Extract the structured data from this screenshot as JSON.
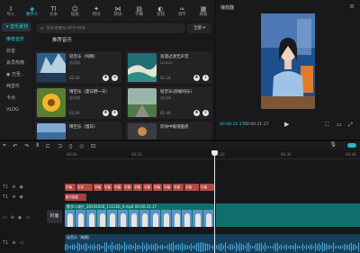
{
  "toolbar": {
    "tools": [
      {
        "icon": "import-icon",
        "glyph": "⇩",
        "label": "导入"
      },
      {
        "icon": "media-icon",
        "glyph": "◈",
        "label": "数字人",
        "active": true
      },
      {
        "icon": "text-icon",
        "glyph": "TI",
        "label": "文本"
      },
      {
        "icon": "sticker-icon",
        "glyph": "☺",
        "label": "贴纸"
      },
      {
        "icon": "effects-icon",
        "glyph": "✦",
        "label": "特效"
      },
      {
        "icon": "transition-icon",
        "glyph": "⋈",
        "label": "转场"
      },
      {
        "icon": "caption-icon",
        "glyph": "▤",
        "label": "字幕"
      },
      {
        "icon": "filter-icon",
        "glyph": "◐",
        "label": "滤镜"
      },
      {
        "icon": "adjust-icon",
        "glyph": "≈",
        "label": "调节"
      },
      {
        "icon": "template-icon",
        "glyph": "▦",
        "label": "模板"
      }
    ]
  },
  "leftnav": {
    "items": [
      {
        "label": "▾ 音乐素材",
        "state": "active"
      },
      {
        "label": "推荐音乐",
        "state": "sub"
      },
      {
        "label": "抖音",
        "state": ""
      },
      {
        "label": "会员热榜",
        "state": ""
      },
      {
        "label": "◉ 万圣...",
        "state": ""
      },
      {
        "label": "纯音乐",
        "state": ""
      },
      {
        "label": "卡点",
        "state": ""
      },
      {
        "label": "VLOG",
        "state": ""
      }
    ]
  },
  "media": {
    "search_placeholder": "搜索歌曲名/歌手/链接",
    "filter_label": "全部 ▾",
    "section_title": "推荐音乐",
    "cards": [
      {
        "title": "轻音乐（纯钢）",
        "artist": "若风纯",
        "duration": "02:50"
      },
      {
        "title": "浪漫过渡无声音",
        "artist": "Lyonzo",
        "duration": "01:18"
      },
      {
        "title": "晴空乐（夏日野一天）",
        "artist": "若风纯",
        "duration": "02:24"
      },
      {
        "title": "轻音乐(舒缓纯乐)",
        "artist": "若风纯",
        "duration": "01:49"
      },
      {
        "title": "晴空乐（慢日）",
        "artist": "",
        "duration": ""
      },
      {
        "title": "欢快中暖夜酷摇",
        "artist": "",
        "duration": ""
      }
    ]
  },
  "player": {
    "title": "播放器",
    "current_time": "00:00:21:17",
    "total_time": "00:00:21:17"
  },
  "timeline": {
    "ruler_ticks": [
      "00:00",
      "00:10",
      "00:20",
      "00:30",
      "00:40"
    ],
    "tracks": [
      "T1",
      "T1",
      "T1"
    ],
    "cover_label": "封面",
    "video_clip_label": "数字人成片_20241028_111156_0.mp4  00:00:21:17",
    "audio_clip_label": "轻音乐（纯钢）",
    "text_segments_row1": [
      "字幕",
      "文本",
      "字幕",
      "字幕",
      "字幕",
      "字幕",
      "字幕",
      "字幕",
      "字幕",
      "字幕",
      "字幕",
      "字幕",
      "字幕"
    ],
    "text_segment_row2": "数字智能"
  }
}
